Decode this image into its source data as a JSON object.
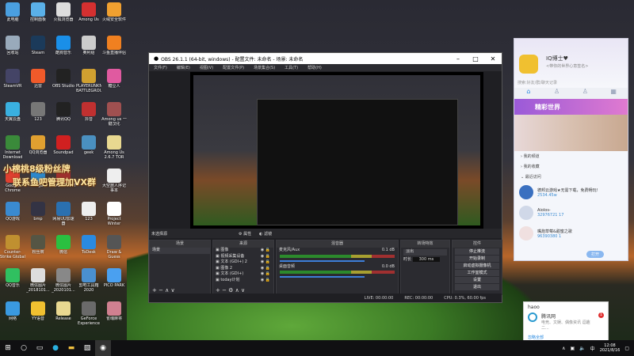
{
  "desktop": {
    "icons": [
      {
        "label": "此电脑",
        "color": "#4a9fe0"
      },
      {
        "label": "控制面板",
        "color": "#5ab0e8"
      },
      {
        "label": "火狐浏览器",
        "color": "#ddd"
      },
      {
        "label": "Among Us",
        "color": "#d43030"
      },
      {
        "label": "火绒安全软件",
        "color": "#f0a030"
      },
      {
        "label": "回收站",
        "color": "#9ab"
      },
      {
        "label": "Steam",
        "color": "#1b3a5a"
      },
      {
        "label": "酷狗音乐",
        "color": "#1a8fe8"
      },
      {
        "label": "奥利给",
        "color": "#ccc"
      },
      {
        "label": "斗鱼直播伴侣",
        "color": "#f08020"
      },
      {
        "label": "SteamVR",
        "color": "#446"
      },
      {
        "label": "迅雷",
        "color": "#f05a2a"
      },
      {
        "label": "OBS Studio",
        "color": "#222"
      },
      {
        "label": "PLAYERUNKNOWN'S BATTLEGROUNDS",
        "color": "#d0a030"
      },
      {
        "label": "糖豆人",
        "color": "#e05aa0"
      },
      {
        "label": "天翼云盘",
        "color": "#3ab0e0"
      },
      {
        "label": "123",
        "color": "#777"
      },
      {
        "label": "腾讯QQ",
        "color": "#222"
      },
      {
        "label": "抖音",
        "color": "#c03030"
      },
      {
        "label": "Among us 一键汉化",
        "color": "#a05050"
      },
      {
        "label": "Internet Download",
        "color": "#3a8a3a"
      },
      {
        "label": "QQ浏览器",
        "color": "#e0a030"
      },
      {
        "label": "Soundpad",
        "color": "#d02020"
      },
      {
        "label": "geek",
        "color": "#4a90c0"
      },
      {
        "label": "Among Us 2.6.7 TOR",
        "color": "#e8d890"
      },
      {
        "label": "Google Chrome",
        "color": "#e04030"
      },
      {
        "label": "Edge",
        "color": "#2a8ad0"
      },
      {
        "label": "BLADEPOINT",
        "color": "#a03030"
      },
      {
        "label": "",
        "color": "transparent"
      },
      {
        "label": "大空旅人序记事本",
        "color": "#eee"
      },
      {
        "label": "QQ游戏",
        "color": "#3a8ad0"
      },
      {
        "label": "bmp",
        "color": "#334"
      },
      {
        "label": "网易UU加速器",
        "color": "#2a70b0"
      },
      {
        "label": "123",
        "color": "#eee"
      },
      {
        "label": "Project Winter",
        "color": "#fff"
      },
      {
        "label": "Counter-Strike Global Off...",
        "color": "#c09030"
      },
      {
        "label": "粉丝牌",
        "color": "#554"
      },
      {
        "label": "微信",
        "color": "#2ac040"
      },
      {
        "label": "ToDesk",
        "color": "#2a8ae0"
      },
      {
        "label": "Draw & Guess",
        "color": "#555"
      },
      {
        "label": "QQ音乐",
        "color": "#30c060"
      },
      {
        "label": "微信图片_2018101...",
        "color": "#ddd"
      },
      {
        "label": "微信图片_2020101...",
        "color": "#888"
      },
      {
        "label": "剪吧工具箱2020",
        "color": "#4a90d0"
      },
      {
        "label": "PICO PARK",
        "color": "#4aa0f0"
      },
      {
        "label": "网络",
        "color": "#3a9ae0"
      },
      {
        "label": "YY语音",
        "color": "#f0c030"
      },
      {
        "label": "Release",
        "color": "#e8d890"
      },
      {
        "label": "GeForce Experience",
        "color": "#6a6a6a"
      },
      {
        "label": "雀魂麻将",
        "color": "#d08090"
      }
    ],
    "banner_line1": "小棉桃8级粉丝牌",
    "banner_line2": "联系鱼吧管理加VX群"
  },
  "obs": {
    "title": "OBS 26.1.1 (64-bit, windows) - 配置文件: 未命名 - 场景: 未命名",
    "menu": [
      "文件(F)",
      "编辑(E)",
      "视图(V)",
      "配置文件(P)",
      "场景集合(S)",
      "工具(T)",
      "帮助(H)"
    ],
    "no_source": "未选择源",
    "props": "属性",
    "filters": "滤镜",
    "scenes": {
      "title": "场景",
      "items": [
        "场景"
      ]
    },
    "sources": {
      "title": "来源",
      "items": [
        "图像",
        "视频采集设备",
        "文本 (GDI+) 2",
        "图像 2",
        "文本 (GDI+)",
        "today计划"
      ]
    },
    "mixer": {
      "title": "混音器",
      "channels": [
        {
          "name": "麦克风/Aux",
          "db": "0.1 dB"
        },
        {
          "name": "桌面音频",
          "db": "0.0 dB"
        }
      ]
    },
    "transitions": {
      "title": "转场特效",
      "type": "淡出",
      "duration_label": "时长",
      "duration": "300 ms"
    },
    "controls": {
      "title": "控件",
      "buttons": [
        "停止推流",
        "开始录制",
        "启动虚拟摄像机",
        "工作室模式",
        "设置",
        "退出"
      ]
    },
    "status": {
      "live": "LIVE: 00:00:00",
      "rec": "REC: 00:00:00",
      "cpu": "CPU: 0.3%, 60.00 fps"
    }
  },
  "qq": {
    "name": "IQ博士♥",
    "signature": "<带你的世界心意签名>",
    "search": "搜索:好友/群/聊天记录",
    "banner": "精彩世界",
    "sections": [
      "我的频道",
      "我的收藏",
      "最近访问"
    ],
    "recent": [
      {
        "title": "德邦云游戏★无需下载，免费畅玩!",
        "sub": "2534.45w"
      },
      {
        "title": "Aiolos-",
        "sub": "32976721",
        "extra": "17"
      },
      {
        "title": "嘴炮草莓&甜蜜之歌",
        "sub": "96390380",
        "extra": "1"
      }
    ],
    "footer_btn": "打开"
  },
  "notification": {
    "app": "haoo",
    "title": "腾讯网",
    "body": "电竞、文娱、偶像资讯 逗趣二...",
    "badge": "1",
    "link": "忽略全部"
  },
  "taskbar": {
    "time": "12:08",
    "date": "2021/8/16",
    "ime": "中"
  }
}
